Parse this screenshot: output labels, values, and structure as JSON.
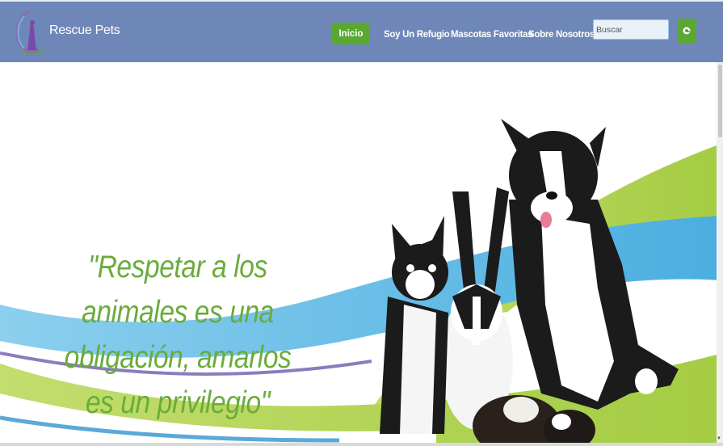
{
  "brand": {
    "name": "Rescue Pets",
    "logo_icon": "rescue-pets-logo-icon"
  },
  "nav": {
    "items": [
      {
        "label": "Inicio",
        "active": true
      },
      {
        "label": "Soy Un Refugio"
      },
      {
        "label": "Mascotas Favoritas"
      },
      {
        "label": "Sobre Nosotros"
      }
    ]
  },
  "search": {
    "placeholder": "Buscar",
    "button_icon": "search-icon"
  },
  "hero": {
    "quote": "\"Respetar a los animales es una obligación, amarlos es un privilegio\"",
    "image": "dog-cat-rabbit-guinea-pigs-photo"
  },
  "colors": {
    "navbar": "#6f87b8",
    "accent_green": "#5aa832",
    "quote_green": "#6aac3b",
    "wave_blue": "#59b7e6",
    "wave_green": "#a9cf4c"
  }
}
